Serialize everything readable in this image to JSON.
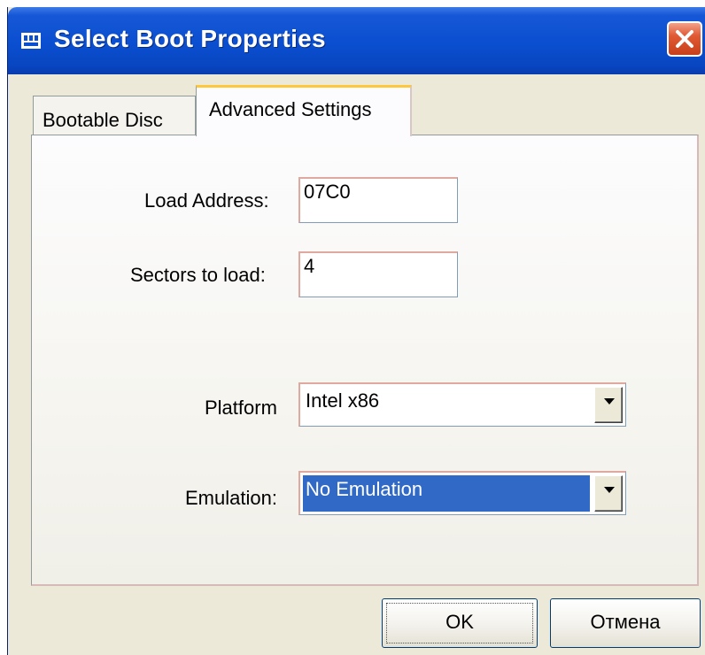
{
  "window": {
    "title": "Select Boot Properties",
    "close_icon": "close-icon"
  },
  "tabs": [
    {
      "label": "Bootable Disc",
      "active": false
    },
    {
      "label": "Advanced Settings",
      "active": true
    }
  ],
  "form": {
    "load_address": {
      "label": "Load Address:",
      "value": "07C0"
    },
    "sectors_to_load": {
      "label": "Sectors to load:",
      "value": "4"
    },
    "platform": {
      "label": "Platform",
      "value": "Intel x86"
    },
    "emulation": {
      "label": "Emulation:",
      "value": "No Emulation"
    }
  },
  "buttons": {
    "ok": "OK",
    "cancel": "Отмена"
  },
  "colors": {
    "titlebar": "#0a4fd0",
    "selection": "#3169c6",
    "close": "#e05a33"
  }
}
